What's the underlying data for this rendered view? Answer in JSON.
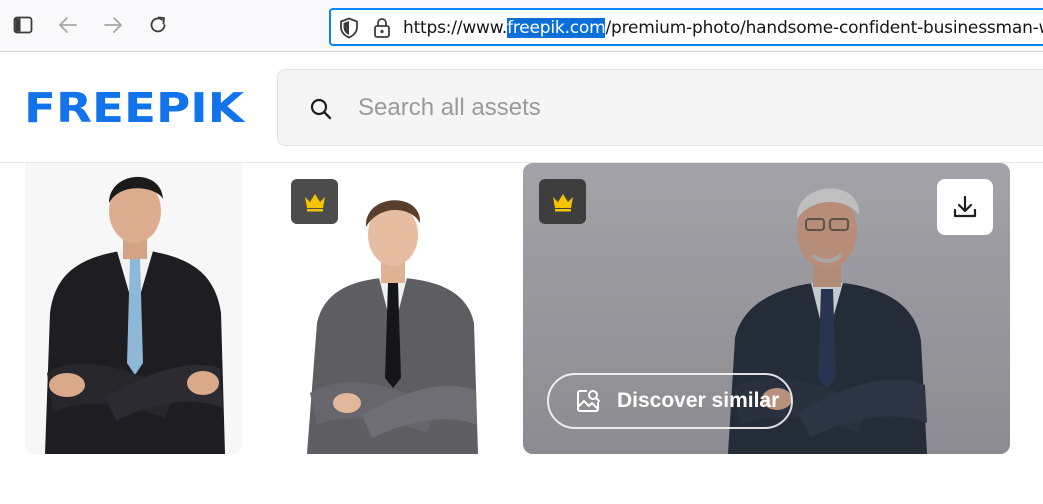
{
  "browser": {
    "url_prefix": "https://www.",
    "url_highlight": "freepik.com",
    "url_suffix": "/premium-photo/handsome-confident-businessman-with-g",
    "icons": [
      "sidebar-icon",
      "back-icon",
      "forward-icon",
      "reload-icon",
      "shield-icon",
      "lock-icon"
    ]
  },
  "header": {
    "logo_text": "FREEPIK",
    "search": {
      "placeholder": "Search all assets"
    }
  },
  "gallery": {
    "cards": [
      {
        "premium": false
      },
      {
        "premium": true
      },
      {
        "premium": true,
        "hover": true,
        "discover_label": "Discover similar"
      }
    ]
  },
  "colors": {
    "brand_blue": "#1273eb",
    "crown_gold": "#f5c400",
    "url_focus": "#0a84ff"
  }
}
